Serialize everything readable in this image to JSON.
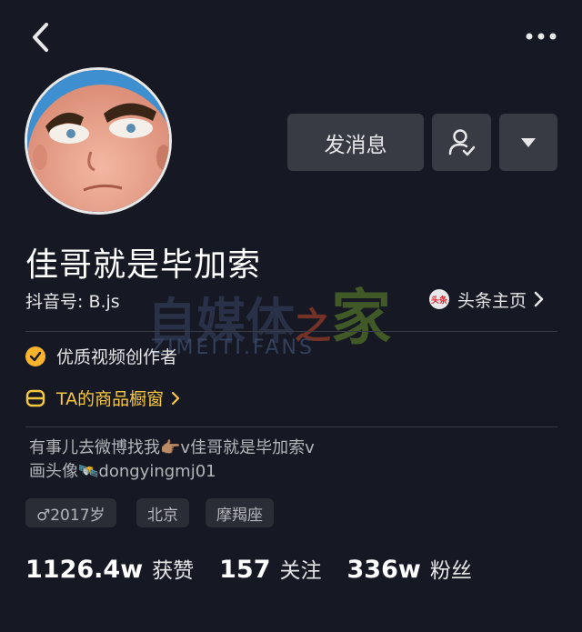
{
  "profile": {
    "name": "佳哥就是毕加索",
    "douyin_id": "抖音号: B.js",
    "send_message_label": "发消息",
    "toutiao_label": "头条主页",
    "toutiao_badge": "头条",
    "creator_badge": "优质视频创作者",
    "shop_label": "TA的商品橱窗",
    "bio_line1": "有事儿去微博找我👉🏽v佳哥就是毕加索v",
    "bio_line2": "画头像🛰️dongyingmj01",
    "tags": [
      "♂2017岁",
      "北京",
      "摩羯座"
    ]
  },
  "stats": {
    "likes_value": "1126.4w",
    "likes_label": "获赞",
    "following_value": "157",
    "following_label": "关注",
    "followers_value": "336w",
    "followers_label": "粉丝"
  },
  "watermark": {
    "part1": "自媒体",
    "part2": "之",
    "part3": "家",
    "sub": "ZIMEITI.FANS"
  },
  "colors": {
    "background": "#161823",
    "button_bg": "#393b44",
    "creator_badge": "#f8b42c",
    "shop_text": "#f8c840"
  },
  "icons": [
    "back-chevron-icon",
    "more-dots-icon",
    "follow-user-icon",
    "dropdown-triangle-icon",
    "toutiao-icon",
    "verified-check-icon",
    "shop-icon",
    "chevron-right-icon"
  ]
}
